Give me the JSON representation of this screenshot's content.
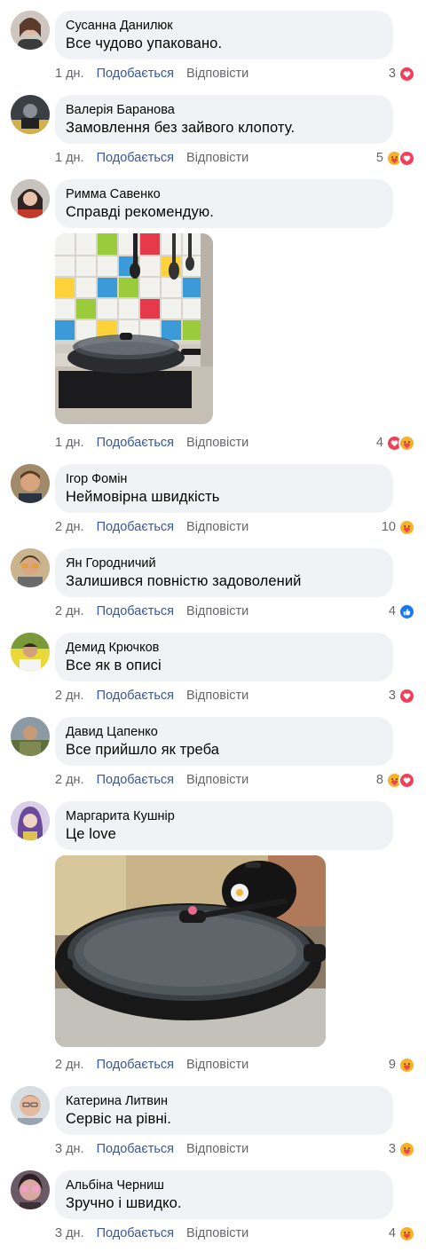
{
  "labels": {
    "like": "Подобається",
    "reply": "Відповісти"
  },
  "colors": {
    "bubble": "#f0f2f5",
    "link": "#385898",
    "muted": "#65676b",
    "love": "#f33e58",
    "like": "#1877f2",
    "care": "#f7b125"
  },
  "comments": [
    {
      "author": "Сусанна Данилюк",
      "text": "Все чудово упаковано.",
      "time": "1 дн.",
      "reactions": [
        "love"
      ],
      "count": "3"
    },
    {
      "author": "Валерія Баранова",
      "text": "Замовлення без зайвого клопоту.",
      "time": "1 дн.",
      "reactions": [
        "care",
        "love"
      ],
      "count": "5"
    },
    {
      "author": "Римма Савенко",
      "text": "Справді рекомендую.",
      "time": "1 дн.",
      "reactions": [
        "love",
        "care"
      ],
      "count": "4",
      "photo": "pan-on-stove-tiled-wall"
    },
    {
      "author": "Ігор Фомін",
      "text": "Неймовірна швидкість",
      "time": "2 дн.",
      "reactions": [
        "care"
      ],
      "count": "10"
    },
    {
      "author": "Ян Городничий",
      "text": "Залишився повністю задоволений",
      "time": "2 дн.",
      "reactions": [
        "like"
      ],
      "count": "4"
    },
    {
      "author": "Демид Крючков",
      "text": "Все як в описі",
      "time": "2 дн.",
      "reactions": [
        "love"
      ],
      "count": "3"
    },
    {
      "author": "Давид Цапенко",
      "text": "Все прийшло як треба",
      "time": "2 дн.",
      "reactions": [
        "care",
        "love"
      ],
      "count": "8"
    },
    {
      "author": "Маргарита Кушнір",
      "text": "Це love",
      "time": "2 дн.",
      "reactions": [
        "care"
      ],
      "count": "9",
      "photo": "pan-with-lid-and-kettle"
    },
    {
      "author": "Катерина Литвин",
      "text": "Сервіс на рівні.",
      "time": "3 дн.",
      "reactions": [
        "care"
      ],
      "count": "3"
    },
    {
      "author": "Альбіна Черниш",
      "text": "Зручно і швидко.",
      "time": "3 дн.",
      "reactions": [
        "care"
      ],
      "count": "4"
    }
  ]
}
